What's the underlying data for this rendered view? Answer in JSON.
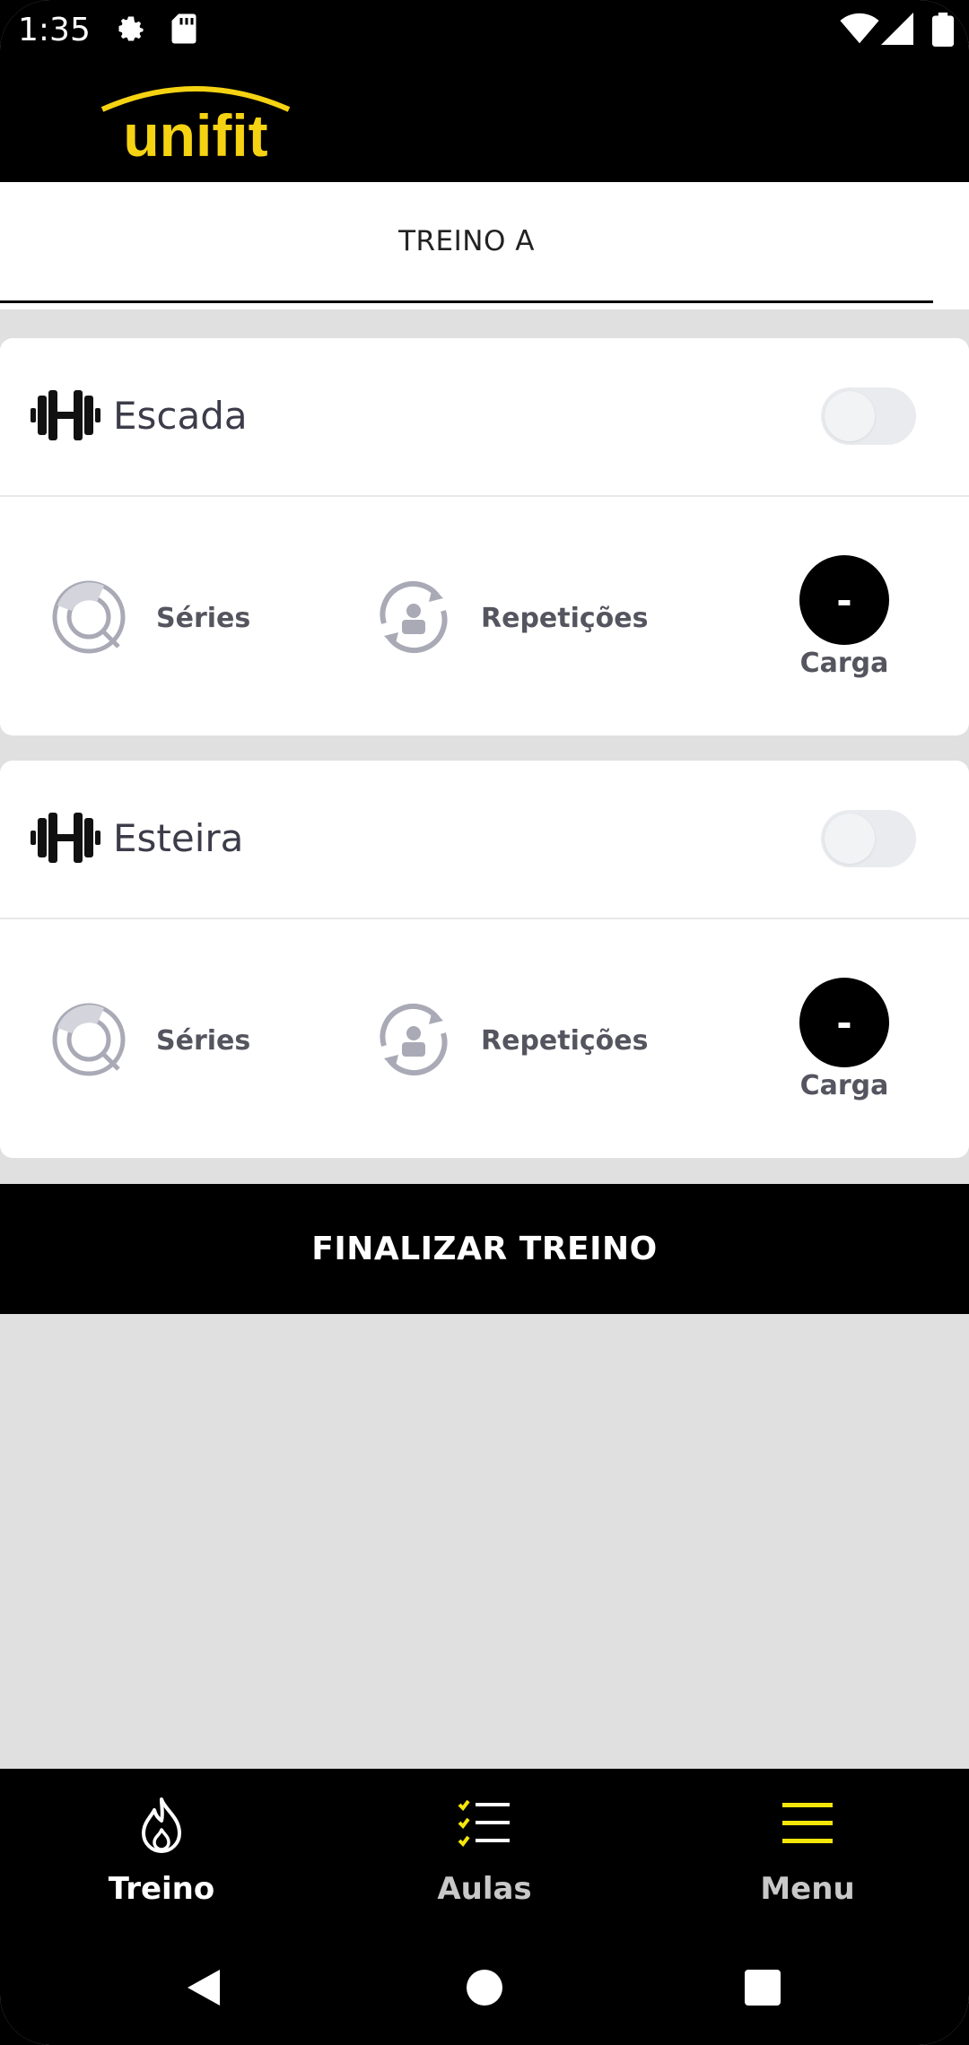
{
  "status_bar": {
    "time": "1:35"
  },
  "brand": {
    "name": "unifit",
    "color": "#f5d312"
  },
  "tabs": [
    {
      "label": "TREINO A",
      "active": true
    }
  ],
  "exercises": [
    {
      "name": "Escada",
      "enabled": false,
      "series_label": "Séries",
      "reps_label": "Repetições",
      "load_value": "-",
      "load_label": "Carga"
    },
    {
      "name": "Esteira",
      "enabled": false,
      "series_label": "Séries",
      "reps_label": "Repetições",
      "load_value": "-",
      "load_label": "Carga"
    }
  ],
  "finish_button": {
    "label": "FINALIZAR TREINO"
  },
  "bottom_nav": [
    {
      "label": "Treino",
      "icon": "flame-icon",
      "active": true
    },
    {
      "label": "Aulas",
      "icon": "checklist-icon",
      "active": false
    },
    {
      "label": "Menu",
      "icon": "hamburger-menu-icon",
      "active": false
    }
  ],
  "colors": {
    "accent": "#f5e60a",
    "active_nav": "#ffffff",
    "inactive_nav": "#c8c8c8",
    "icon_gray": "#a9aab6"
  }
}
